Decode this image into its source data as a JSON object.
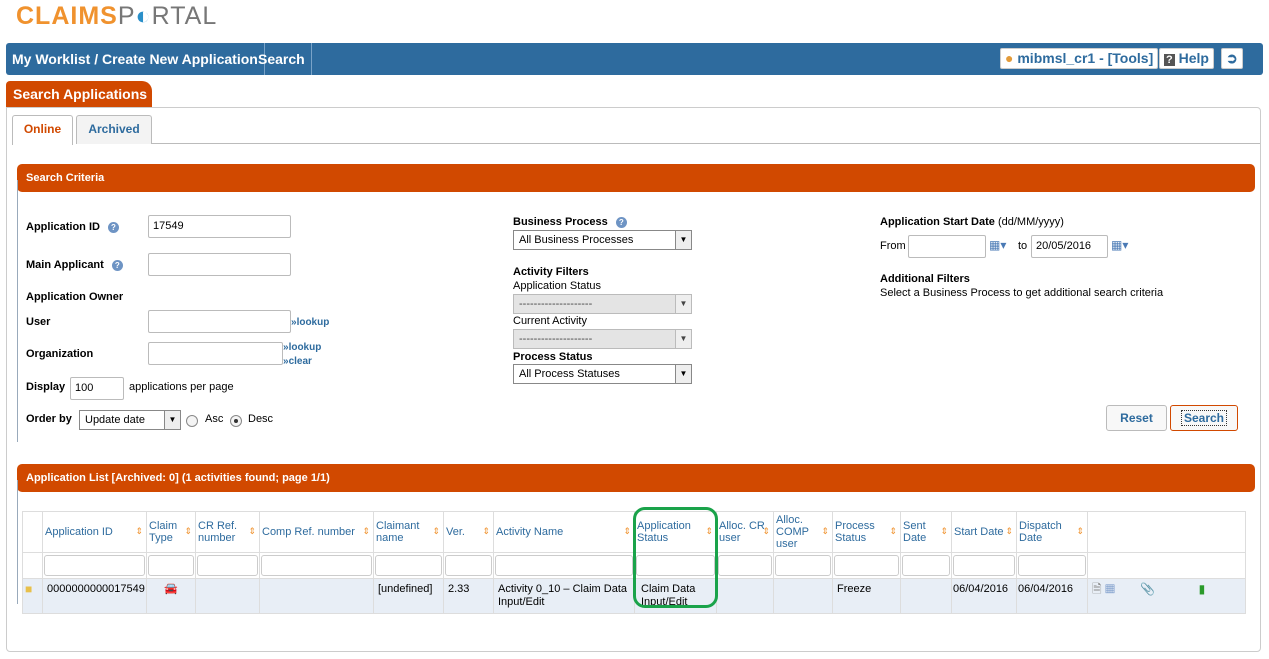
{
  "logo": {
    "part1": "CLAIMS",
    "part2": "PORTAL"
  },
  "nav": {
    "items": [
      "My Worklist / Create New Application",
      "Search"
    ],
    "user": "mibmsl_cr1 - [Tools]",
    "help": "Help"
  },
  "section_tab": "Search Applications",
  "tabs": [
    {
      "label": "Online",
      "active": true
    },
    {
      "label": "Archived",
      "active": false
    }
  ],
  "search": {
    "header": "Search Criteria",
    "application_id_label": "Application ID",
    "application_id": "17549",
    "main_applicant_label": "Main Applicant",
    "main_applicant": "",
    "owner_label": "Application Owner",
    "user_label": "User",
    "org_label": "Organization",
    "lookup": "lookup",
    "clear": "clear",
    "display_label": "Display",
    "display_value": "100",
    "per_page": "applications per page",
    "order_label": "Order by",
    "order_value": "Update date",
    "asc": "Asc",
    "desc": "Desc",
    "order_dir": "Desc",
    "business_process_label": "Business Process",
    "business_process": "All Business Processes",
    "activity_filters": "Activity Filters",
    "app_status_label": "Application Status",
    "app_status": "--------------------",
    "current_activity_label": "Current Activity",
    "current_activity": "--------------------",
    "process_status_label": "Process Status",
    "process_status": "All Process Statuses",
    "start_date_label": "Application Start Date",
    "start_date_fmt": "(dd/MM/yyyy)",
    "from_label": "From",
    "from_value": "",
    "to_label": "to",
    "to_value": "20/05/2016",
    "additional_label": "Additional Filters",
    "additional_text": "Select a Business Process to get additional search criteria",
    "reset": "Reset",
    "search": "Search"
  },
  "list": {
    "header": "Application List [Archived: 0] (1 activities found; page 1/1)",
    "columns": [
      "",
      "Application ID",
      "Claim Type",
      "CR Ref. number",
      "Comp Ref. number",
      "Claimant name",
      "Ver.",
      "Activity Name",
      "Application Status",
      "Alloc. CR user",
      "Alloc. COMP user",
      "Process Status",
      "Sent Date",
      "Start Date",
      "Dispatch Date",
      ""
    ],
    "rows": [
      {
        "application_id": "0000000000017549",
        "claim_type": "car-icon",
        "cr_ref": "",
        "comp_ref": "",
        "claimant": "[undefined]",
        "ver": "2.33",
        "activity": "Activity 0_10 – Claim Data Input/Edit",
        "app_status": "Claim Data Input/Edit",
        "alloc_cr": "",
        "alloc_comp": "",
        "process_status": "Freeze",
        "sent_date": "",
        "start_date": "06/04/2016",
        "dispatch_date": "06/04/2016"
      }
    ]
  },
  "colors": {
    "nav": "#2e6b9e",
    "accent": "#d14900",
    "highlight": "#1aa34a"
  }
}
